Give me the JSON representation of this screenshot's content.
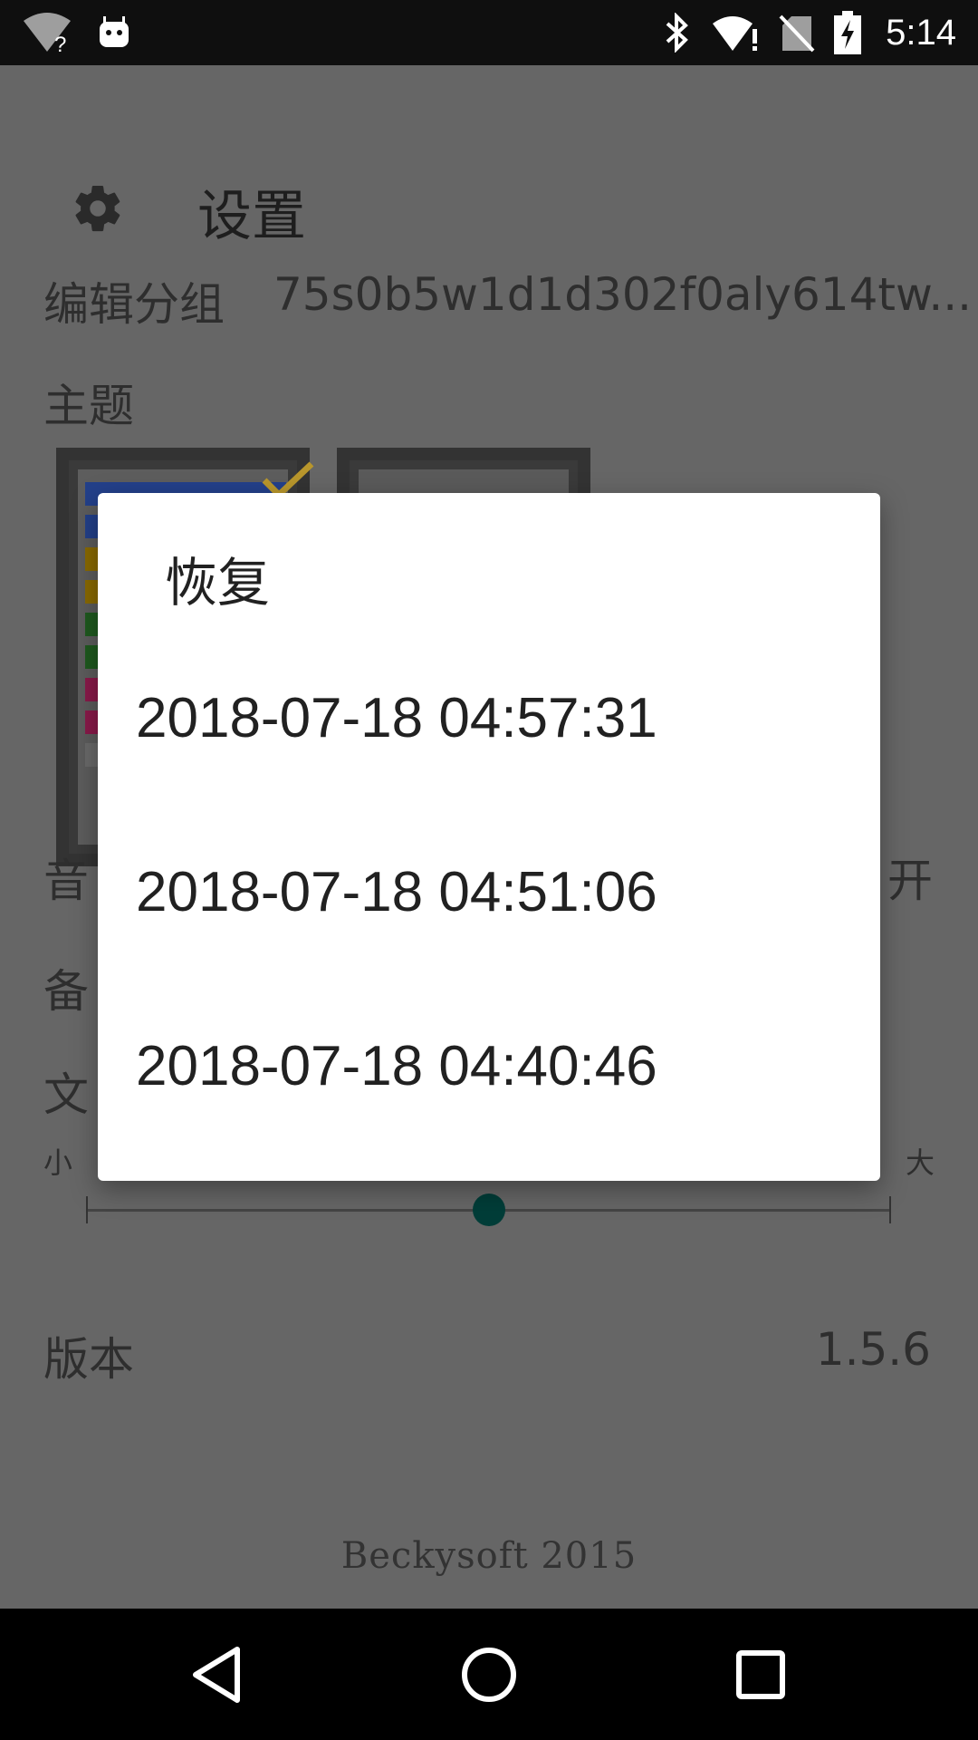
{
  "status_bar": {
    "time": "5:14",
    "icons": [
      "wifi-question-icon",
      "android-robot-icon",
      "bluetooth-icon",
      "signal-alert-icon",
      "no-sim-icon",
      "battery-charging-icon"
    ]
  },
  "settings": {
    "title": "设置",
    "edit_group_label": "编辑分组",
    "edit_group_value": "75s0b5w1d1d302f0aly614tw...",
    "theme_label": "主题",
    "sound_label": "音",
    "sound_value": "开",
    "backup_label": "备",
    "text_label": "文",
    "slider_small": "小",
    "slider_large": "大",
    "slider_value": 0.5,
    "version_label": "版本",
    "version_value": "1.5.6"
  },
  "footer": {
    "brand": "Beckysoft 2015"
  },
  "dialog": {
    "title": "恢复",
    "items": [
      "2018-07-18 04:57:31",
      "2018-07-18 04:51:06",
      "2018-07-18 04:40:46"
    ]
  },
  "colors": {
    "dim_background": "#666666",
    "dialog_background": "#ffffff",
    "slider_thumb": "#013d38",
    "theme_check": "#b8962c"
  }
}
